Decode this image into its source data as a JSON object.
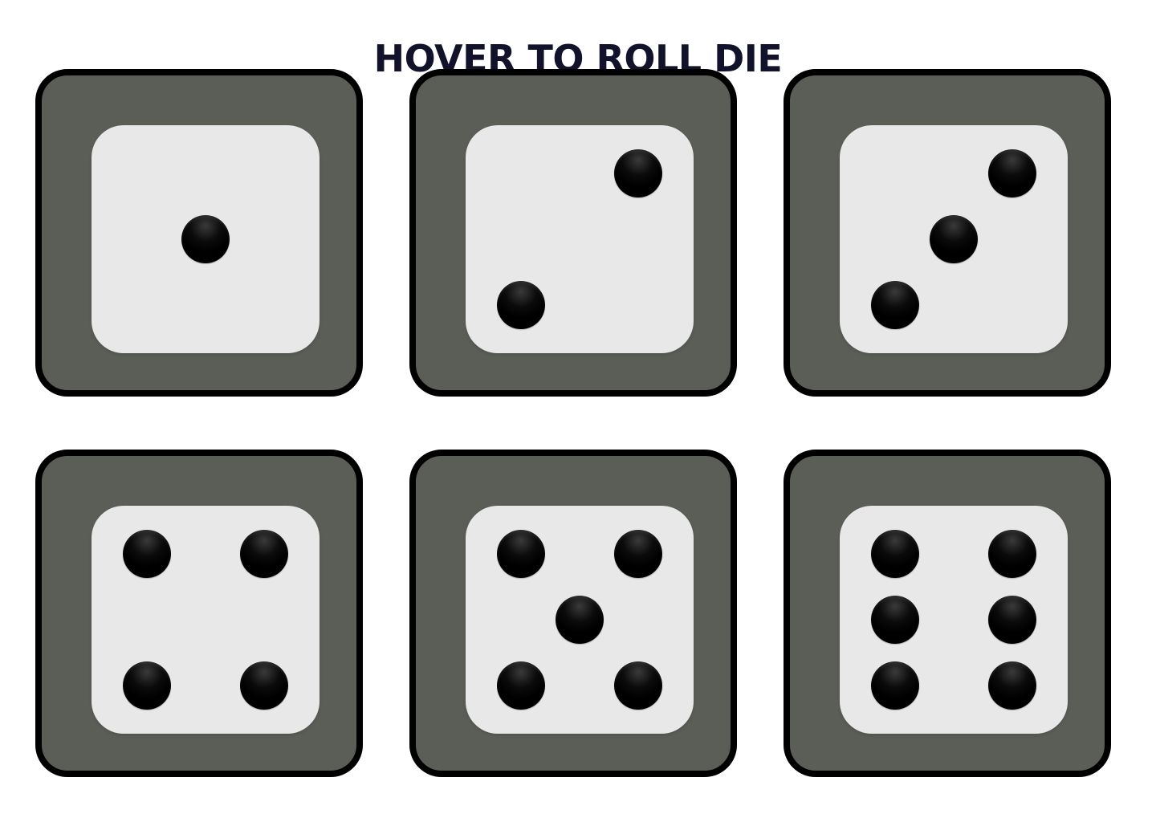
{
  "page": {
    "title": "HOVER TO ROLL DIE"
  },
  "dice": [
    {
      "value": 1,
      "pips": [
        "mc"
      ]
    },
    {
      "value": 2,
      "pips": [
        "tr",
        "bl"
      ]
    },
    {
      "value": 3,
      "pips": [
        "tr",
        "mc",
        "bl"
      ]
    },
    {
      "value": 4,
      "pips": [
        "tl",
        "tr",
        "bl",
        "br"
      ]
    },
    {
      "value": 5,
      "pips": [
        "tl",
        "tr",
        "mc",
        "bl",
        "br"
      ]
    },
    {
      "value": 6,
      "pips": [
        "tl",
        "tr",
        "ml",
        "mr",
        "bl",
        "br"
      ]
    }
  ],
  "colors": {
    "title": "#12122b",
    "tile_background": "#5b5e57",
    "tile_border": "#000000",
    "die_face": "#e8e8e8",
    "pip": "#000000"
  }
}
